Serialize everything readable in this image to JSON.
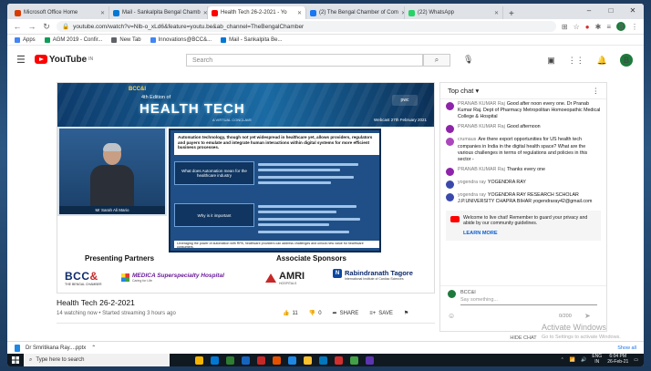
{
  "browser": {
    "tabs": [
      {
        "label": "Microsoft Office Home",
        "color": "#d83b01"
      },
      {
        "label": "Mail - Sankalpita Bengal Chamb",
        "color": "#0078d4"
      },
      {
        "label": "Health Tech 26-2-2021 - Yo",
        "color": "#ff0000",
        "active": true
      },
      {
        "label": "(2) The Bengal Chamber of Com",
        "color": "#1877f2"
      },
      {
        "label": "(22) WhatsApp",
        "color": "#25d366"
      }
    ],
    "new_tab": "+",
    "url": "youtube.com/watch?v=Nlb-o_xLd6&feature=youtu.be&ab_channel=TheBengalChamber",
    "profile_initial": "B",
    "bookmarks": [
      {
        "label": "Apps",
        "color": "#4285f4"
      },
      {
        "label": "AGM 2019 - Confir...",
        "color": "#0f9d58"
      },
      {
        "label": "New Tab",
        "color": "#5f6368"
      },
      {
        "label": "Innovations@BCC&...",
        "color": "#4285f4"
      },
      {
        "label": "Mail - Sankalpita Be...",
        "color": "#0078d4"
      }
    ]
  },
  "youtube": {
    "logo_text": "YouTube",
    "logo_sup": "IN",
    "search_placeholder": "Search",
    "avatar_initial": "B"
  },
  "video": {
    "banner_org": "BCC&I",
    "banner_edition": "4th Edition of",
    "banner_title": "HEALTH TECH",
    "banner_sub": "A VIRTUAL CONCLAVE",
    "banner_date": "Webcast 27th February 2021",
    "banner_partner": "pwc",
    "speaker_name": "Mr Sarah Ali Mario",
    "slide_heading": "Automation technology, though not yet widespread in healthcare yet, allows providers, regulators and payers to emulate and integrate human interactions within digital systems for more efficient business processes.",
    "slide_box1": "What does Automation mean for the healthcare industry",
    "slide_box2": "Why is it important",
    "slide_footer": "Leveraging the power of automation with RPA, healthcare providers can address challenges and unlock new value for healthcare consumers.",
    "presenting_partners": "Presenting Partners",
    "associate_sponsors": "Associate Sponsors",
    "bcc_logo": "BCC",
    "bcc_amp": "&",
    "bcc_sub": "THE BENGAL CHAMBER",
    "medica_logo": "MEDICA Superspecialty Hospital",
    "medica_sub": "Caring for Life",
    "amri_logo": "AMRI",
    "amri_sub": "HOSPITALS",
    "rt_logo": "Rabindranath Tagore",
    "rt_sub": "International Institute of Cardiac Sciences"
  },
  "meta": {
    "title": "Health Tech 26-2-2021",
    "status": "14 watching now • Started streaming 3 hours ago",
    "likes": "11",
    "dislikes": "0",
    "share_label": "SHARE",
    "save_label": "SAVE"
  },
  "chat": {
    "header": "Top chat",
    "messages": [
      {
        "author": "PRANAB KUMAR Raj",
        "text": "Good after noon every one. Dr Pranab Kumar Raj. Dept of Pharmacy Metropolitan Homoeopathic Medical College & Hospital",
        "color": "#8e24aa"
      },
      {
        "author": "PRANAB KUMAR Raj",
        "text": "Good afternoon",
        "color": "#8e24aa"
      },
      {
        "author": "crumaus",
        "text": "Are there export opportunities for US health tech companies in India in the digital health space? What are the various challenges in terms of regulations and policies in this sector -",
        "color": "#ab47bc"
      },
      {
        "author": "PRANAB KUMAR Raj",
        "text": "Thanks every one",
        "color": "#8e24aa"
      },
      {
        "author": "yogendra ray",
        "text": "YOGENDRA RAY",
        "color": "#3949ab"
      },
      {
        "author": "yogendra ray",
        "text": "YOGENDRA RAY RESEARCH SCHOLAR J.P.UNIVERSITY CHAPRA BIHAR yogendraray42@gmail.com",
        "color": "#3949ab"
      }
    ],
    "welcome": "Welcome to live chat! Remember to guard your privacy and abide by our community guidelines.",
    "learn_more": "LEARN MORE",
    "input_name": "BCC&I",
    "input_placeholder": "Say something...",
    "char_count": "0/200",
    "hide_chat": "HIDE CHAT"
  },
  "watermark": {
    "line1": "Activate Windows",
    "line2": "Go to Settings to activate Windows."
  },
  "download": {
    "file": "Dr Smritikana Ray....pptx",
    "show_all": "Show all"
  },
  "taskbar": {
    "search_placeholder": "Type here to search",
    "apps": [
      "#f5b400",
      "#0078d4",
      "#2e7d32",
      "#1565c0",
      "#c62828",
      "#e65100",
      "#1e88e5",
      "#fbc02d",
      "#0277bd",
      "#d32f2f",
      "#43a047",
      "#5e35b1"
    ],
    "lang": "ENG",
    "region": "IN",
    "time": "6:04 PM",
    "date": "26-Feb-21"
  }
}
